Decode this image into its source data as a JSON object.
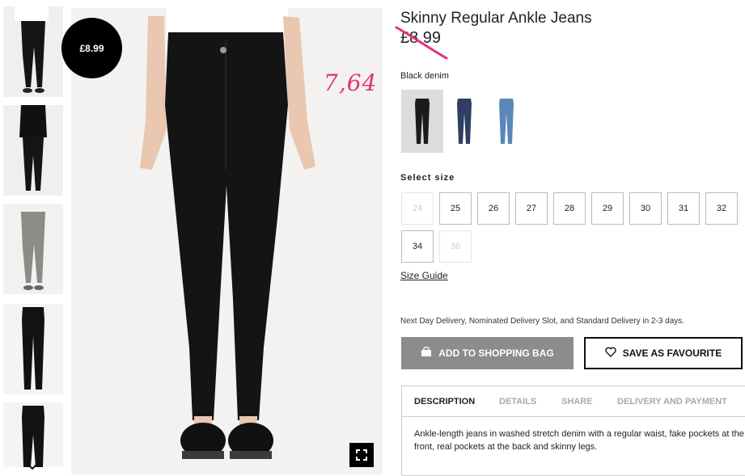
{
  "product": {
    "title": "Skinny Regular Ankle Jeans",
    "old_price": "£8.99",
    "badge_price": "£8.99",
    "annotated_price": "7,64",
    "color_label": "Black denim",
    "swatches": [
      {
        "name": "black denim",
        "color": "#1b1b1b",
        "selected": true
      },
      {
        "name": "dark blue denim",
        "color": "#2e3f63",
        "selected": false
      },
      {
        "name": "light blue denim",
        "color": "#5b86b8",
        "selected": false
      }
    ]
  },
  "sizes": {
    "label": "Select size",
    "options": [
      {
        "label": "24",
        "available": false
      },
      {
        "label": "25",
        "available": true
      },
      {
        "label": "26",
        "available": true
      },
      {
        "label": "27",
        "available": true
      },
      {
        "label": "28",
        "available": true
      },
      {
        "label": "29",
        "available": true
      },
      {
        "label": "30",
        "available": true
      },
      {
        "label": "31",
        "available": true
      },
      {
        "label": "32",
        "available": true
      },
      {
        "label": "34",
        "available": true
      },
      {
        "label": "36",
        "available": false
      }
    ],
    "guide": "Size Guide"
  },
  "delivery_text": "Next Day Delivery, Nominated Delivery Slot, and Standard Delivery in 2-3 days.",
  "buttons": {
    "add_to_bag": "ADD TO SHOPPING BAG",
    "save_favourite": "SAVE AS FAVOURITE"
  },
  "tabs": [
    {
      "label": "DESCRIPTION",
      "active": true
    },
    {
      "label": "DETAILS",
      "active": false
    },
    {
      "label": "SHARE",
      "active": false
    },
    {
      "label": "DELIVERY AND PAYMENT",
      "active": false
    }
  ],
  "description": "Ankle-length jeans in washed stretch denim with a regular waist, fake pockets at the front, real pockets at the back and skinny legs.",
  "colors": {
    "annotation": "#e0327e",
    "bag_button": "#8c8c8c",
    "selected_swatch": "#dcdcdc"
  },
  "icons": {
    "bag": "shopping-bag-icon",
    "heart": "heart-icon",
    "fullscreen": "fullscreen-icon",
    "chevron": "chevron-down-icon"
  }
}
